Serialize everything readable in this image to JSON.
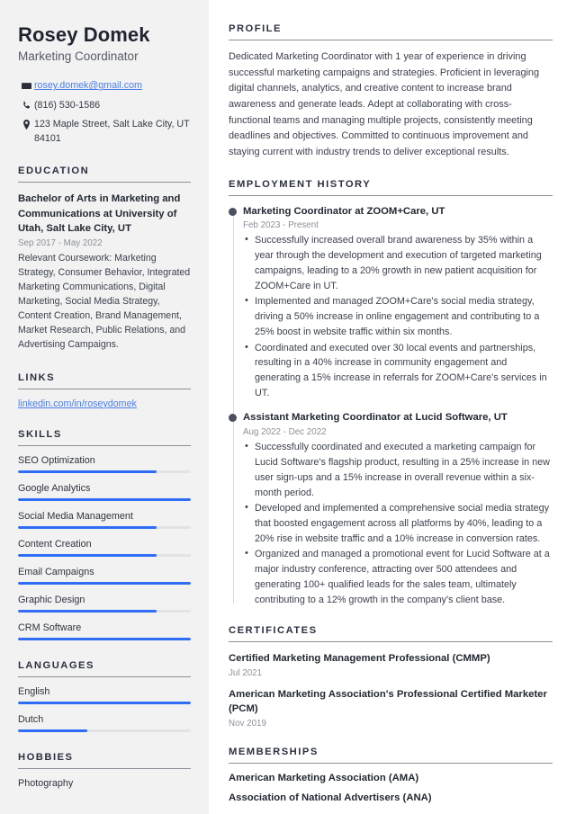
{
  "header": {
    "name": "Rosey Domek",
    "job_title": "Marketing Coordinator",
    "contacts": [
      {
        "icon": "envelope-icon",
        "text": "rosey.domek@gmail.com",
        "is_link": true
      },
      {
        "icon": "phone-icon",
        "text": "(816) 530-1586",
        "is_link": false
      },
      {
        "icon": "map-pin-icon",
        "text": "123 Maple Street, Salt Lake City, UT 84101",
        "is_link": false
      }
    ]
  },
  "education": {
    "heading": "EDUCATION",
    "degree": "Bachelor of Arts in Marketing and Communications at University of Utah, Salt Lake City, UT",
    "date": "Sep 2017 - May 2022",
    "description": "Relevant Coursework: Marketing Strategy, Consumer Behavior, Integrated Marketing Communications, Digital Marketing, Social Media Strategy, Content Creation, Brand Management, Market Research, Public Relations, and Advertising Campaigns."
  },
  "links": {
    "heading": "LINKS",
    "items": [
      {
        "label": "linkedin.com/in/roseydomek"
      }
    ]
  },
  "skills": {
    "heading": "SKILLS",
    "items": [
      {
        "label": "SEO Optimization",
        "level": 80
      },
      {
        "label": "Google Analytics",
        "level": 100
      },
      {
        "label": "Social Media Management",
        "level": 80
      },
      {
        "label": "Content Creation",
        "level": 80
      },
      {
        "label": "Email Campaigns",
        "level": 100
      },
      {
        "label": "Graphic Design",
        "level": 80
      },
      {
        "label": "CRM Software",
        "level": 100
      }
    ]
  },
  "languages": {
    "heading": "LANGUAGES",
    "items": [
      {
        "label": "English",
        "level": 100
      },
      {
        "label": "Dutch",
        "level": 40
      }
    ]
  },
  "hobbies": {
    "heading": "HOBBIES",
    "items": [
      {
        "label": "Photography"
      }
    ]
  },
  "profile": {
    "heading": "PROFILE",
    "text": "Dedicated Marketing Coordinator with 1 year of experience in driving successful marketing campaigns and strategies. Proficient in leveraging digital channels, analytics, and creative content to increase brand awareness and generate leads. Adept at collaborating with cross-functional teams and managing multiple projects, consistently meeting deadlines and objectives. Committed to continuous improvement and staying current with industry trends to deliver exceptional results."
  },
  "employment": {
    "heading": "EMPLOYMENT HISTORY",
    "jobs": [
      {
        "title": "Marketing Coordinator at ZOOM+Care, UT",
        "date": "Feb 2023 - Present",
        "bullets": [
          "Successfully increased overall brand awareness by 35% within a year through the development and execution of targeted marketing campaigns, leading to a 20% growth in new patient acquisition for ZOOM+Care in UT.",
          "Implemented and managed ZOOM+Care's social media strategy, driving a 50% increase in online engagement and contributing to a 25% boost in website traffic within six months.",
          "Coordinated and executed over 30 local events and partnerships, resulting in a 40% increase in community engagement and generating a 15% increase in referrals for ZOOM+Care's services in UT."
        ]
      },
      {
        "title": "Assistant Marketing Coordinator at Lucid Software, UT",
        "date": "Aug 2022 - Dec 2022",
        "bullets": [
          "Successfully coordinated and executed a marketing campaign for Lucid Software's flagship product, resulting in a 25% increase in new user sign-ups and a 15% increase in overall revenue within a six-month period.",
          "Developed and implemented a comprehensive social media strategy that boosted engagement across all platforms by 40%, leading to a 20% rise in website traffic and a 10% increase in conversion rates.",
          "Organized and managed a promotional event for Lucid Software at a major industry conference, attracting over 500 attendees and generating 100+ qualified leads for the sales team, ultimately contributing to a 12% growth in the company's client base."
        ]
      }
    ]
  },
  "certificates": {
    "heading": "CERTIFICATES",
    "items": [
      {
        "title": "Certified Marketing Management Professional (CMMP)",
        "date": "Jul 2021"
      },
      {
        "title": "American Marketing Association's Professional Certified Marketer (PCM)",
        "date": "Nov 2019"
      }
    ]
  },
  "memberships": {
    "heading": "MEMBERSHIPS",
    "items": [
      {
        "title": "American Marketing Association (AMA)"
      },
      {
        "title": "Association of National Advertisers (ANA)"
      }
    ]
  },
  "colors": {
    "accent": "#2f6df4",
    "link": "#4a7fe8",
    "heading": "#2b3040",
    "sidebar_bg": "#f2f2f2"
  }
}
